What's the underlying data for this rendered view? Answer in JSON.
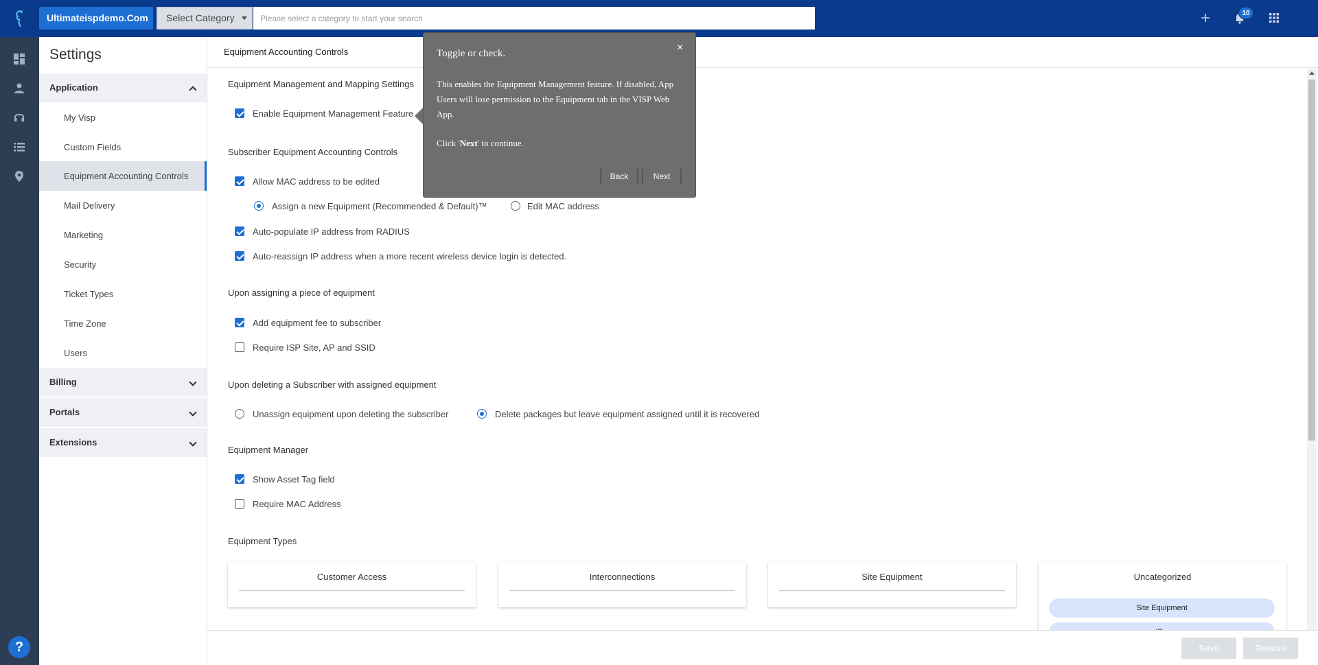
{
  "topbar": {
    "domain": "Ultimateispdemo.Com",
    "category_select": "Select Category",
    "search_placeholder": "Please select a category to start your search",
    "notification_count": "10"
  },
  "rail": {
    "icons": [
      "dashboard-icon",
      "person-icon",
      "headset-icon",
      "list-icon",
      "location-pin-icon"
    ],
    "help_label": "?"
  },
  "settings": {
    "title": "Settings",
    "sections": [
      {
        "label": "Application",
        "expanded": true,
        "items": [
          {
            "label": "My Visp"
          },
          {
            "label": "Custom Fields"
          },
          {
            "label": "Equipment Accounting Controls",
            "active": true
          },
          {
            "label": "Mail Delivery"
          },
          {
            "label": "Marketing"
          },
          {
            "label": "Security"
          },
          {
            "label": "Ticket Types"
          },
          {
            "label": "Time Zone"
          },
          {
            "label": "Users"
          }
        ]
      },
      {
        "label": "Billing",
        "expanded": false
      },
      {
        "label": "Portals",
        "expanded": false
      },
      {
        "label": "Extensions",
        "expanded": false
      }
    ]
  },
  "main": {
    "title": "Equipment Accounting Controls",
    "groups": {
      "mapping": {
        "title": "Equipment Management and Mapping Settings",
        "enable_feature": {
          "label": "Enable Equipment Management Feature",
          "checked": true
        }
      },
      "subscriber": {
        "title": "Subscriber Equipment Accounting Controls",
        "allow_mac": {
          "label": "Allow MAC address to be edited",
          "checked": true
        },
        "radio_assign_new": {
          "label": "Assign a new Equipment (Recommended & Default)™",
          "selected": true
        },
        "radio_edit_mac": {
          "label": "Edit MAC address",
          "selected": false
        },
        "auto_populate_ip": {
          "label": "Auto-populate IP address from RADIUS",
          "checked": true
        },
        "auto_reassign_ip": {
          "label": "Auto-reassign IP address when a more recent wireless device login is detected.",
          "checked": true
        }
      },
      "assigning": {
        "title": "Upon assigning a piece of equipment",
        "add_fee": {
          "label": "Add equipment fee to subscriber",
          "checked": true
        },
        "require_site": {
          "label": "Require ISP Site, AP and SSID",
          "checked": false
        }
      },
      "deleting": {
        "title": "Upon deleting a Subscriber with assigned equipment",
        "radio_unassign": {
          "label": "Unassign equipment upon deleting the subscriber",
          "selected": false
        },
        "radio_delete_packages": {
          "label": "Delete packages but leave equipment assigned until it is recovered",
          "selected": true
        }
      },
      "manager": {
        "title": "Equipment Manager",
        "show_asset_tag": {
          "label": "Show Asset Tag field",
          "checked": true
        },
        "require_mac": {
          "label": "Require MAC Address",
          "checked": false
        }
      },
      "types": {
        "title": "Equipment Types",
        "cards": [
          {
            "title": "Customer Access",
            "chips": []
          },
          {
            "title": "Interconnections",
            "chips": []
          },
          {
            "title": "Site Equipment",
            "chips": []
          },
          {
            "title": "Uncategorized",
            "chips": [
              "Site Equipment",
              "IP..."
            ]
          }
        ]
      }
    }
  },
  "footer": {
    "save_label": "Save",
    "restore_label": "Restore"
  },
  "tooltip": {
    "title": "Toggle or check.",
    "close": "×",
    "body": "This enables the Equipment Management feature. If disabled, App Users will lose permission to the Equipment tab in the VISP Web App.",
    "continue_prefix": "Click '",
    "continue_bold": "Next",
    "continue_suffix": "' to continue.",
    "back_label": "Back",
    "next_label": "Next"
  },
  "colors": {
    "topbar": "#0a3a8c",
    "accent": "#1e6fd4",
    "rail": "#2d3e54",
    "tooltip_bg": "#6e6e6e"
  }
}
